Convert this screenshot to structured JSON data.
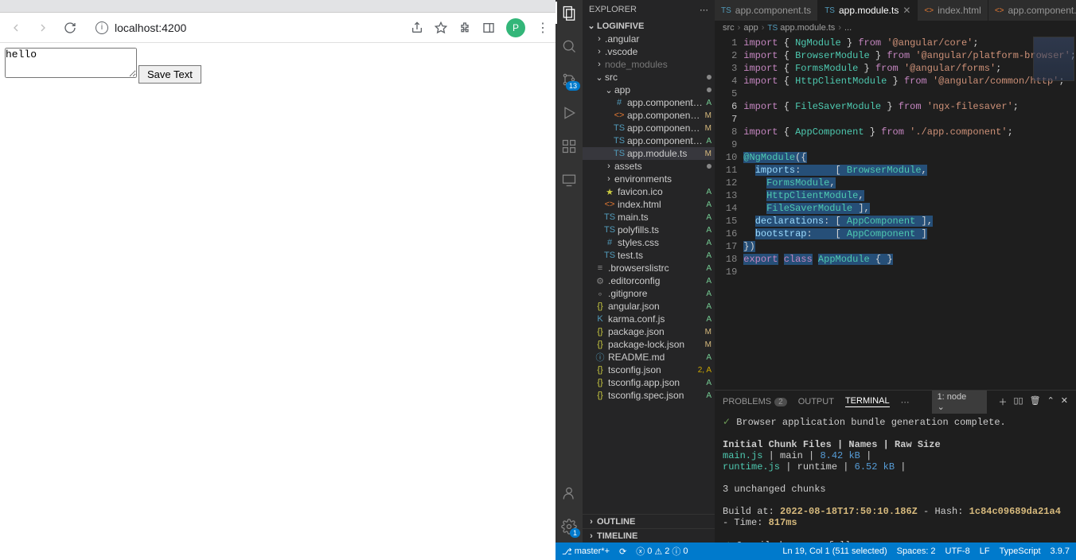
{
  "browser": {
    "url": "localhost:4200",
    "profile_letter": "P",
    "textarea_value": "hello",
    "button_label": "Save Text"
  },
  "vscode": {
    "explorer_label": "EXPLORER",
    "project_name": "LOGINFIVE",
    "outline_label": "OUTLINE",
    "timeline_label": "TIMELINE",
    "scm_badge": "13",
    "tree": [
      {
        "type": "folder",
        "label": ".angular",
        "indent": 14,
        "open": false
      },
      {
        "type": "folder",
        "label": ".vscode",
        "indent": 14,
        "open": false
      },
      {
        "type": "folder",
        "label": "node_modules",
        "indent": 14,
        "open": false,
        "dim": true
      },
      {
        "type": "folder",
        "label": "src",
        "indent": 14,
        "open": true,
        "dot": true
      },
      {
        "type": "folder",
        "label": "app",
        "indent": 26,
        "open": true,
        "dot": true
      },
      {
        "type": "file",
        "label": "app.component.css",
        "indent": 38,
        "icon": "#",
        "iconColor": "#519aba",
        "status": "A"
      },
      {
        "type": "file",
        "label": "app.component.html",
        "indent": 38,
        "icon": "<>",
        "iconColor": "#e37933",
        "status": "M"
      },
      {
        "type": "file",
        "label": "app.component.ts",
        "indent": 38,
        "icon": "TS",
        "iconColor": "#519aba",
        "status": "M"
      },
      {
        "type": "file",
        "label": "app.component.spec.ts",
        "indent": 38,
        "icon": "TS",
        "iconColor": "#519aba",
        "status": "A"
      },
      {
        "type": "file",
        "label": "app.module.ts",
        "indent": 38,
        "icon": "TS",
        "iconColor": "#519aba",
        "status": "M",
        "selected": true
      },
      {
        "type": "folder",
        "label": "assets",
        "indent": 26,
        "open": false,
        "dot": true
      },
      {
        "type": "folder",
        "label": "environments",
        "indent": 26,
        "open": false
      },
      {
        "type": "file",
        "label": "favicon.ico",
        "indent": 26,
        "icon": "★",
        "iconColor": "#cbcb41",
        "status": "A"
      },
      {
        "type": "file",
        "label": "index.html",
        "indent": 26,
        "icon": "<>",
        "iconColor": "#e37933",
        "status": "A"
      },
      {
        "type": "file",
        "label": "main.ts",
        "indent": 26,
        "icon": "TS",
        "iconColor": "#519aba",
        "status": "A"
      },
      {
        "type": "file",
        "label": "polyfills.ts",
        "indent": 26,
        "icon": "TS",
        "iconColor": "#519aba",
        "status": "A"
      },
      {
        "type": "file",
        "label": "styles.css",
        "indent": 26,
        "icon": "#",
        "iconColor": "#519aba",
        "status": "A"
      },
      {
        "type": "file",
        "label": "test.ts",
        "indent": 26,
        "icon": "TS",
        "iconColor": "#519aba",
        "status": "A"
      },
      {
        "type": "file",
        "label": ".browserslistrc",
        "indent": 14,
        "icon": "≡",
        "iconColor": "#888",
        "status": "A"
      },
      {
        "type": "file",
        "label": ".editorconfig",
        "indent": 14,
        "icon": "⚙",
        "iconColor": "#888",
        "status": "A"
      },
      {
        "type": "file",
        "label": ".gitignore",
        "indent": 14,
        "icon": "",
        "iconColor": "#888",
        "status": "A"
      },
      {
        "type": "file",
        "label": "angular.json",
        "indent": 14,
        "icon": "{}",
        "iconColor": "#cbcb41",
        "status": "A"
      },
      {
        "type": "file",
        "label": "karma.conf.js",
        "indent": 14,
        "icon": "K",
        "iconColor": "#519aba",
        "status": "A"
      },
      {
        "type": "file",
        "label": "package.json",
        "indent": 14,
        "icon": "{}",
        "iconColor": "#cbcb41",
        "status": "M"
      },
      {
        "type": "file",
        "label": "package-lock.json",
        "indent": 14,
        "icon": "{}",
        "iconColor": "#cbcb41",
        "status": "M"
      },
      {
        "type": "file",
        "label": "README.md",
        "indent": 14,
        "icon": "ⓘ",
        "iconColor": "#519aba",
        "status": "A"
      },
      {
        "type": "file",
        "label": "tsconfig.json",
        "indent": 14,
        "icon": "{}",
        "iconColor": "#cbcb41",
        "status": "2, A",
        "warn": true
      },
      {
        "type": "file",
        "label": "tsconfig.app.json",
        "indent": 14,
        "icon": "{}",
        "iconColor": "#cbcb41",
        "status": "A"
      },
      {
        "type": "file",
        "label": "tsconfig.spec.json",
        "indent": 14,
        "icon": "{}",
        "iconColor": "#cbcb41",
        "status": "A"
      }
    ],
    "tabs": [
      {
        "label": "app.component.ts",
        "icon": "TS",
        "active": false
      },
      {
        "label": "app.module.ts",
        "icon": "TS",
        "active": true
      },
      {
        "label": "index.html",
        "icon": "<>",
        "active": false
      },
      {
        "label": "app.component.h",
        "icon": "<>",
        "active": false
      }
    ],
    "breadcrumb": [
      "src",
      "app",
      "app.module.ts",
      "..."
    ],
    "code": [
      [
        [
          "kw",
          "import"
        ],
        [
          "pun",
          " { "
        ],
        [
          "id",
          "NgModule"
        ],
        [
          "pun",
          " } "
        ],
        [
          "kw",
          "from"
        ],
        [
          "pun",
          " "
        ],
        [
          "str",
          "'@angular/core'"
        ],
        [
          "pun",
          ";"
        ]
      ],
      [
        [
          "kw",
          "import"
        ],
        [
          "pun",
          " { "
        ],
        [
          "id",
          "BrowserModule"
        ],
        [
          "pun",
          " } "
        ],
        [
          "kw",
          "from"
        ],
        [
          "pun",
          " "
        ],
        [
          "str",
          "'@angular/platform-browser'"
        ],
        [
          "pun",
          ";"
        ]
      ],
      [
        [
          "kw",
          "import"
        ],
        [
          "pun",
          " { "
        ],
        [
          "id",
          "FormsModule"
        ],
        [
          "pun",
          " } "
        ],
        [
          "kw",
          "from"
        ],
        [
          "pun",
          " "
        ],
        [
          "str",
          "'@angular/forms'"
        ],
        [
          "pun",
          ";"
        ]
      ],
      [
        [
          "kw",
          "import"
        ],
        [
          "pun",
          " { "
        ],
        [
          "id",
          "HttpClientModule"
        ],
        [
          "pun",
          " } "
        ],
        [
          "kw",
          "from"
        ],
        [
          "pun",
          " "
        ],
        [
          "str",
          "'@angular/common/http'"
        ],
        [
          "pun",
          ";"
        ]
      ],
      [],
      [
        [
          "kw",
          "import"
        ],
        [
          "pun",
          " { "
        ],
        [
          "id",
          "FileSaverModule"
        ],
        [
          "pun",
          " } "
        ],
        [
          "kw",
          "from"
        ],
        [
          "pun",
          " "
        ],
        [
          "str",
          "'ngx-filesaver'"
        ],
        [
          "pun",
          ";"
        ]
      ],
      [],
      [
        [
          "kw",
          "import"
        ],
        [
          "pun",
          " { "
        ],
        [
          "id",
          "AppComponent"
        ],
        [
          "pun",
          " } "
        ],
        [
          "kw",
          "from"
        ],
        [
          "pun",
          " "
        ],
        [
          "str",
          "'./app.component'"
        ],
        [
          "pun",
          ";"
        ]
      ],
      [],
      [
        [
          "dec",
          "@NgModule"
        ],
        [
          "pun",
          "({"
        ]
      ],
      [
        [
          "pun",
          "  "
        ],
        [
          "fn",
          "imports"
        ],
        [
          "pun",
          ":      [ "
        ],
        [
          "id",
          "BrowserModule"
        ],
        [
          "pun",
          ","
        ]
      ],
      [
        [
          "pun",
          "    "
        ],
        [
          "id",
          "FormsModule"
        ],
        [
          "pun",
          ","
        ]
      ],
      [
        [
          "pun",
          "    "
        ],
        [
          "id",
          "HttpClientModule"
        ],
        [
          "pun",
          ","
        ]
      ],
      [
        [
          "pun",
          "    "
        ],
        [
          "id",
          "FileSaverModule"
        ],
        [
          "pun",
          " ],"
        ]
      ],
      [
        [
          "pun",
          "  "
        ],
        [
          "fn",
          "declarations"
        ],
        [
          "pun",
          ": [ "
        ],
        [
          "id",
          "AppComponent"
        ],
        [
          "pun",
          " ],"
        ]
      ],
      [
        [
          "pun",
          "  "
        ],
        [
          "fn",
          "bootstrap"
        ],
        [
          "pun",
          ":    [ "
        ],
        [
          "id",
          "AppComponent"
        ],
        [
          "pun",
          " ]"
        ]
      ],
      [
        [
          "pun",
          "})"
        ]
      ],
      [
        [
          "kw",
          "export"
        ],
        [
          "pun",
          " "
        ],
        [
          "kw",
          "class"
        ],
        [
          "pun",
          " "
        ],
        [
          "id",
          "AppModule"
        ],
        [
          "pun",
          " { }"
        ]
      ],
      []
    ],
    "terminal": {
      "tabs": {
        "problems": "PROBLEMS",
        "problems_count": "2",
        "output": "OUTPUT",
        "terminal": "TERMINAL"
      },
      "selector": "1: node",
      "lines": {
        "gen_complete": "Browser application bundle generation complete.",
        "header": "Initial Chunk Files | Names   | Raw Size",
        "row1_file": "main.js",
        "row1_name": "main",
        "row1_size": "8.42 kB",
        "row2_file": "runtime.js",
        "row2_name": "runtime",
        "row2_size": "6.52 kB",
        "unchanged": "3 unchanged chunks",
        "build_prefix": "Build at:",
        "build_date": "2022-08-18T17:50:10.186Z",
        "hash_prefix": "- Hash:",
        "hash": "1c84c09689da21a4",
        "time_prefix": "- Time:",
        "time": "817ms",
        "compiled": "Compiled successfully.",
        "prompt": "❚"
      }
    },
    "statusbar": {
      "branch": "master*+",
      "sync": "⟳",
      "errors": "0",
      "warnings": "2",
      "info": "0",
      "position": "Ln 19, Col 1 (511 selected)",
      "spaces": "Spaces: 2",
      "encoding": "UTF-8",
      "eol": "LF",
      "lang": "TypeScript",
      "version": "3.9.7"
    }
  }
}
